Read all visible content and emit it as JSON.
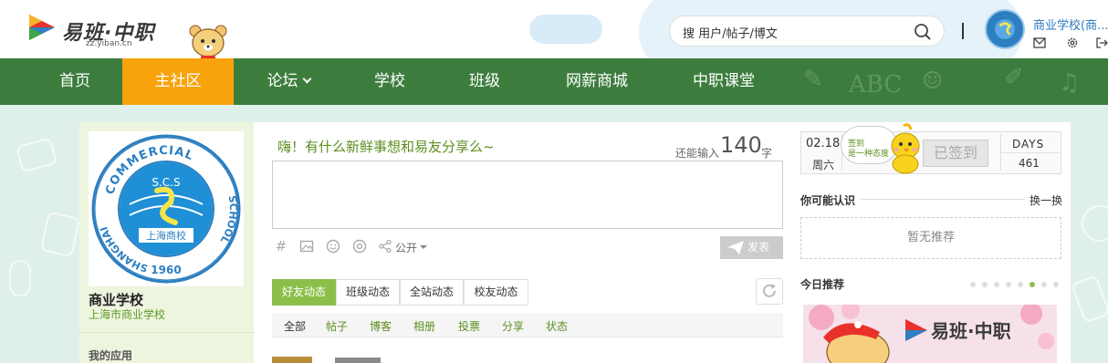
{
  "header": {
    "logo_text": "易班·中职",
    "logo_sub": "zz.yiban.cn",
    "search_value": "搜 用户/帖子/博文",
    "username": "商业学校(商..."
  },
  "nav": {
    "items": [
      {
        "label": "首页"
      },
      {
        "label": "主社区",
        "active": true
      },
      {
        "label": "论坛",
        "has_dropdown": true
      },
      {
        "label": "学校"
      },
      {
        "label": "班级"
      },
      {
        "label": "网薪商城"
      },
      {
        "label": "中职课堂"
      }
    ]
  },
  "profile": {
    "logo_text_top": "COMMERCIAL",
    "logo_text_left": "SHANGHAI",
    "logo_text_right": "SCHOOL",
    "logo_initials": "S.C.S",
    "logo_chinese": "上海商校",
    "logo_year": "1960",
    "name": "商业学校",
    "full_name": "上海市商业学校",
    "my_apps": "我的应用"
  },
  "post": {
    "prompt": "嗨！有什么新鲜事想和易友分享么~",
    "remain_label": "还能输入",
    "remain_count": "140",
    "remain_unit": "字",
    "visibility": "公开",
    "publish": "发表"
  },
  "feed": {
    "tabs": [
      "好友动态",
      "班级动态",
      "全站动态",
      "校友动态"
    ],
    "active_tab": 0,
    "filters": [
      "全部",
      "帖子",
      "博客",
      "相册",
      "投票",
      "分享",
      "状态"
    ],
    "active_filter": 0
  },
  "sign": {
    "date": "02.18",
    "weekday": "周六",
    "bubble_line1": "签到",
    "bubble_line2": "是一种态度",
    "button": "已签到",
    "days_label": "DAYS",
    "days_count": "461"
  },
  "sidebar": {
    "maybe_title": "你可能认识",
    "swap": "换一换",
    "no_rec": "暂无推荐",
    "today_title": "今日推荐",
    "banner_text": "易班·中职",
    "dots": 8,
    "active_dot": 5
  },
  "colors": {
    "nav_bg": "#3c7d3e",
    "nav_active": "#f8a30c",
    "accent_green": "#8cbf4a",
    "link_blue": "#2a79c0"
  }
}
